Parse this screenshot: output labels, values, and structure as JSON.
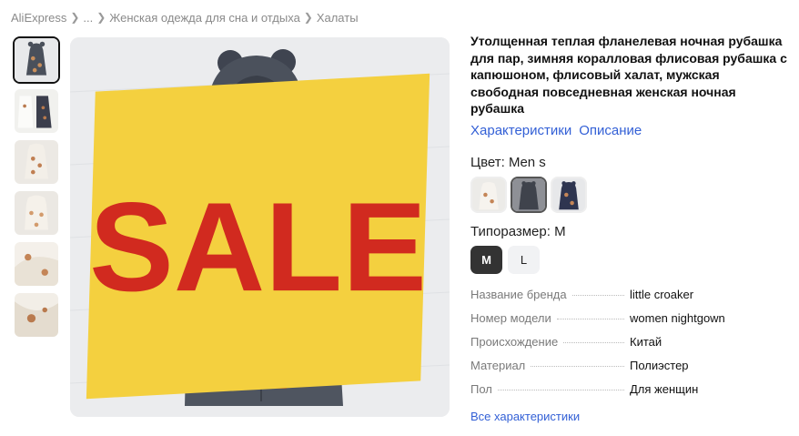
{
  "breadcrumb": {
    "items": [
      "AliExpress",
      "...",
      "Женская одежда для сна и отдыха",
      "Халаты"
    ],
    "separator_icon": "chevron-right-icon"
  },
  "gallery": {
    "thumbnails": [
      {
        "name": "gray-robe-bear-ears",
        "colors": [
          "#4a505b",
          "#c98f5c"
        ]
      },
      {
        "name": "white-robe-pair",
        "colors": [
          "#f1f1ee",
          "#3b3e4c"
        ]
      },
      {
        "name": "white-robe-bears",
        "colors": [
          "#f3efe8",
          "#c07f52"
        ]
      },
      {
        "name": "white-robe-hood",
        "colors": [
          "#f5f1ea",
          "#d39b6c"
        ]
      },
      {
        "name": "white-fleece-detail",
        "colors": [
          "#f4f0ea",
          "#c48557"
        ]
      },
      {
        "name": "white-fleece-closeup",
        "colors": [
          "#f2eee7",
          "#b97a4e"
        ]
      }
    ],
    "active_index": 0,
    "badge": "SALE",
    "badge_color": "#f4d03f",
    "badge_text_color": "#d12a1f"
  },
  "product": {
    "title": "Утолщенная теплая фланелевая ночная рубашка для пар, зимняя коралловая флисовая рубашка с капюшоном, флисовый халат, мужская свободная повседневная женская ночная рубашка",
    "tabs": [
      "Характеристики",
      "Описание"
    ],
    "link_color": "#3360d6"
  },
  "color_option": {
    "label": "Цвет: Men s",
    "swatches": [
      {
        "name": "white-bears"
      },
      {
        "name": "gray-men"
      },
      {
        "name": "navy-bears"
      }
    ],
    "selected_index": 1
  },
  "size_option": {
    "label": "Типоразмер: M",
    "options": [
      "M",
      "L"
    ],
    "selected": "M"
  },
  "specs": [
    {
      "key": "Название бренда",
      "value": "little croaker"
    },
    {
      "key": "Номер модели",
      "value": "women nightgown"
    },
    {
      "key": "Происхождение",
      "value": "Китай"
    },
    {
      "key": "Материал",
      "value": "Полиэстер"
    },
    {
      "key": "Пол",
      "value": "Для женщин"
    }
  ],
  "all_specs_link": "Все характеристики"
}
